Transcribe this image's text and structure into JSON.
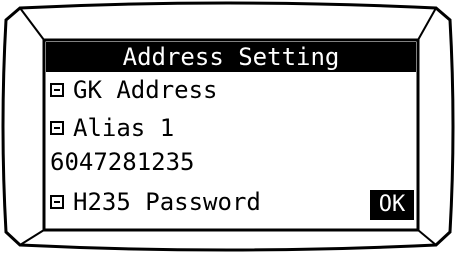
{
  "screen": {
    "title": "Address Setting",
    "items": [
      {
        "label": "GK Address",
        "icon": "menu-box-icon"
      },
      {
        "label": "Alias 1",
        "icon": "menu-box-icon"
      },
      {
        "label": "6047281235"
      },
      {
        "label": "H235 Password",
        "icon": "menu-box-icon"
      }
    ],
    "ok_label": "OK"
  }
}
